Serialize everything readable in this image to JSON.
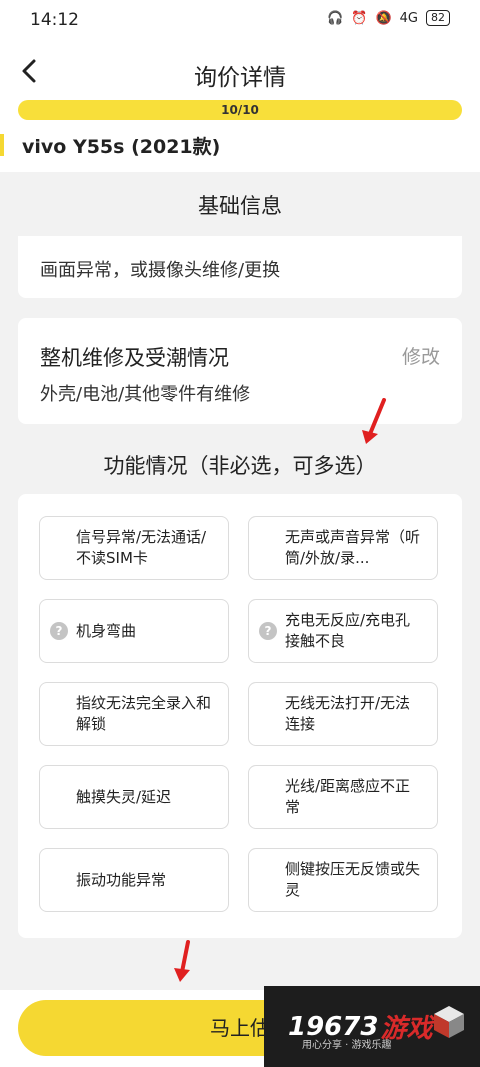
{
  "status": {
    "time": "14:12",
    "network": "4G",
    "battery": "82"
  },
  "header": {
    "title": "询价详情",
    "progress": "10/10",
    "model": "vivo Y55s (2021款)"
  },
  "basic": {
    "title": "基础信息",
    "partial_text": "画面异常，或摄像头维修/更换"
  },
  "repair": {
    "heading": "整机维修及受潮情况",
    "modify": "修改",
    "detail": "外壳/电池/其他零件有维修"
  },
  "functions": {
    "title": "功能情况（非必选，可多选）",
    "options": [
      {
        "label": "信号异常/无法通话/不读SIM卡"
      },
      {
        "label": "无声或声音异常（听筒/外放/录..."
      },
      {
        "label": "机身弯曲",
        "help": "?"
      },
      {
        "label": "充电无反应/充电孔接触不良",
        "help": "?"
      },
      {
        "label": "指纹无法完全录入和解锁"
      },
      {
        "label": "无线无法打开/无法连接"
      },
      {
        "label": "触摸失灵/延迟"
      },
      {
        "label": "光线/距离感应不正常"
      },
      {
        "label": "振动功能异常"
      },
      {
        "label": "侧键按压无反馈或失灵"
      }
    ]
  },
  "cta": {
    "label": "马上估"
  },
  "watermark": {
    "number": "19673",
    "brand": "游戏",
    "slogan": "用心分享 · 游戏乐趣"
  },
  "colors": {
    "accent": "#f5d832",
    "arrow": "#e02020"
  }
}
